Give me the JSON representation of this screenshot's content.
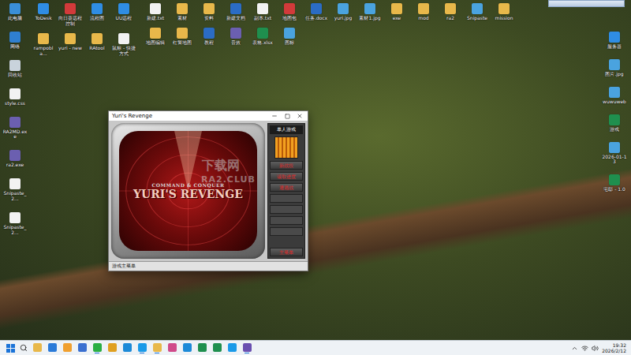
{
  "desktop": {
    "left_column": [
      {
        "label": "此电脑",
        "kind": "pc"
      },
      {
        "label": "网络",
        "kind": "net"
      },
      {
        "label": "回收站",
        "kind": "bin"
      },
      {
        "label": "style.css",
        "kind": "file"
      },
      {
        "label": "RA2MD.exe",
        "kind": "exe"
      },
      {
        "label": "ra2.exe",
        "kind": "exe"
      },
      {
        "label": "Snipaste_2...",
        "kind": "file"
      },
      {
        "label": "Snipaste_2...",
        "kind": "file"
      }
    ],
    "shortcuts": [
      {
        "label": "ToDesk",
        "kind": "app"
      },
      {
        "label": "向日葵远程控制",
        "kind": "red"
      },
      {
        "label": "流程图",
        "kind": "app"
      },
      {
        "label": "UU远程",
        "kind": "app"
      },
      {
        "label": "rampobla...",
        "kind": "folder"
      },
      {
        "label": "yuri - new",
        "kind": "folder"
      },
      {
        "label": "RAtool",
        "kind": "folder"
      },
      {
        "label": "鼠标 - 快捷方式",
        "kind": "file"
      }
    ],
    "files": [
      {
        "label": "新建.txt",
        "kind": "file"
      },
      {
        "label": "素材",
        "kind": "folder"
      },
      {
        "label": "资料",
        "kind": "folder"
      },
      {
        "label": "新建文档",
        "kind": "doc"
      },
      {
        "label": "副本.txt",
        "kind": "file"
      },
      {
        "label": "地图包",
        "kind": "red"
      },
      {
        "label": "任务.docx",
        "kind": "doc"
      },
      {
        "label": "yuri.jpg",
        "kind": "image"
      },
      {
        "label": "素材1.jpg",
        "kind": "image"
      },
      {
        "label": "exe",
        "kind": "folder"
      },
      {
        "label": "mod",
        "kind": "folder"
      },
      {
        "label": "ra2",
        "kind": "folder"
      },
      {
        "label": "Snipaste",
        "kind": "image"
      },
      {
        "label": "mission",
        "kind": "folder"
      },
      {
        "label": "地图编辑",
        "kind": "folder"
      },
      {
        "label": "红警地图",
        "kind": "folder"
      },
      {
        "label": "教程",
        "kind": "doc"
      },
      {
        "label": "音效",
        "kind": "exe"
      },
      {
        "label": "表格.xlsx",
        "kind": "sheet"
      },
      {
        "label": "图标",
        "kind": "image"
      }
    ],
    "right_column": [
      {
        "label": "服务器",
        "kind": "app"
      },
      {
        "label": "图片.jpg",
        "kind": "image"
      },
      {
        "label": "wuwuweb",
        "kind": "image"
      },
      {
        "label": "游戏",
        "kind": "sheet"
      },
      {
        "label": "2026-01-13",
        "kind": "image"
      },
      {
        "label": "宅邸 - 1.0",
        "kind": "sheet"
      }
    ]
  },
  "window": {
    "title": "Yuri's Revenge",
    "logo": {
      "top": "COMMAND & CONQUER",
      "main": "YURI'S REVENGE"
    },
    "panel_header": "单人游戏",
    "menu_buttons": [
      "新战役",
      "读取进度",
      "遭遇战"
    ],
    "bottom_button": "主菜单",
    "status": "游戏主菜单"
  },
  "watermark": {
    "main": "下载网",
    "sub": "RA2.CLUB"
  },
  "taskbar": {
    "apps": [
      {
        "kind": "explorer",
        "active": false
      },
      {
        "kind": "mail",
        "active": false
      },
      {
        "kind": "search",
        "active": false
      },
      {
        "kind": "store",
        "active": false
      },
      {
        "kind": "wechat",
        "active": true
      },
      {
        "kind": "game",
        "active": false
      },
      {
        "kind": "edge",
        "active": false
      },
      {
        "kind": "qq",
        "active": true
      },
      {
        "kind": "explorer",
        "active": true
      },
      {
        "kind": "photo",
        "active": false
      },
      {
        "kind": "edge",
        "active": false
      },
      {
        "kind": "excel",
        "active": false
      },
      {
        "kind": "excel",
        "active": false
      },
      {
        "kind": "qq",
        "active": false
      },
      {
        "kind": "yuri",
        "active": true
      }
    ],
    "time": "19:32",
    "date": "2026/2/12"
  }
}
